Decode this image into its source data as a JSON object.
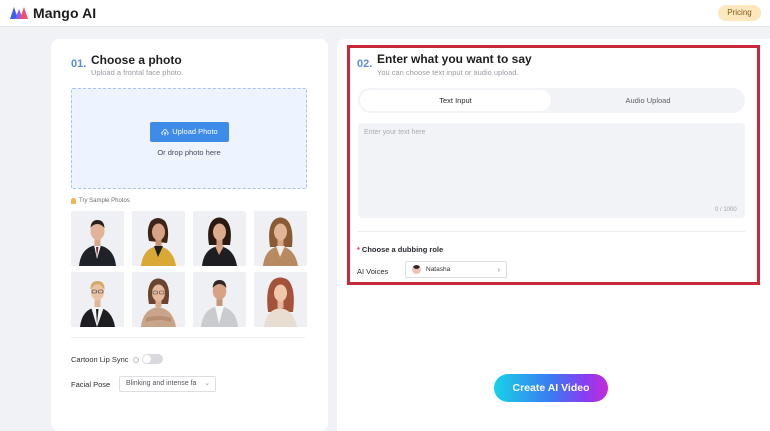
{
  "header": {
    "brand": "Mango AI",
    "pricing_label": "Pricing"
  },
  "left": {
    "step_num": "01.",
    "title": "Choose a photo",
    "subtitle": "Upload a frontal face photo.",
    "upload_label": "Upload Photo",
    "drop_text": "Or drop photo here",
    "sample_label": "Try Sample Photos",
    "cartoon_lip_sync_label": "Cartoon Lip Sync",
    "cartoon_lip_sync_on": false,
    "facial_pose_label": "Facial Pose",
    "facial_pose_value": "Blinking and intense fa"
  },
  "right": {
    "step_num": "02.",
    "title": "Enter what you want to say",
    "subtitle": "You can choose text input or audio upload.",
    "tabs": [
      {
        "label": "Text Input",
        "active": true
      },
      {
        "label": "Audio Upload",
        "active": false
      }
    ],
    "text_placeholder": "Enter your text here",
    "counter": "0 / 1000",
    "dubbing_required_mark": "*",
    "dubbing_label": "Choose a dubbing role",
    "voices_label": "AI Voices",
    "voice_value": "Natasha",
    "create_label": "Create AI Video"
  },
  "colors": {
    "accent_blue": "#3f8be8",
    "highlight_red": "#c7283a",
    "pricing_bg": "#fde7bd"
  },
  "sample_photos": [
    {
      "name": "man-black-suit"
    },
    {
      "name": "woman-yellow-blazer"
    },
    {
      "name": "woman-black-blazer"
    },
    {
      "name": "woman-brown-blazer"
    },
    {
      "name": "woman-white-shirt-tie"
    },
    {
      "name": "woman-glasses-beige"
    },
    {
      "name": "man-grey-suit"
    },
    {
      "name": "woman-red-hair"
    }
  ]
}
